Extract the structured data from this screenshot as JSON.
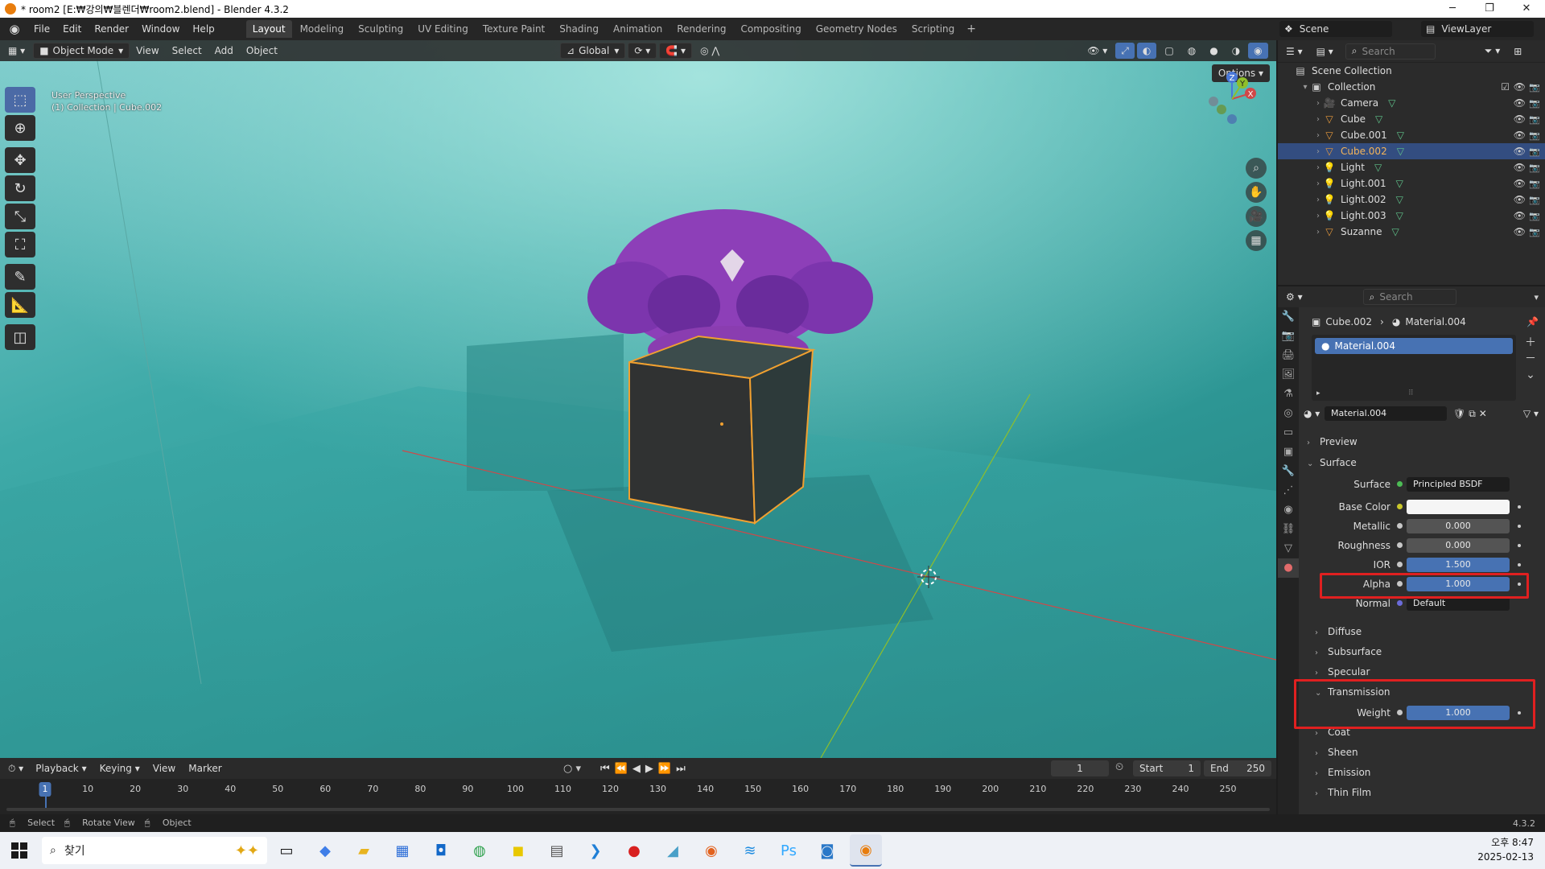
{
  "window": {
    "title": "* room2 [E:₩강의₩블렌더₩room2.blend] - Blender 4.3.2",
    "controls": [
      "─",
      "❐",
      "✕"
    ]
  },
  "menu": [
    "File",
    "Edit",
    "Render",
    "Window",
    "Help"
  ],
  "workspaces": [
    "Layout",
    "Modeling",
    "Sculpting",
    "UV Editing",
    "Texture Paint",
    "Shading",
    "Animation",
    "Rendering",
    "Compositing",
    "Geometry Nodes",
    "Scripting"
  ],
  "workspace_add": "+",
  "scene": "Scene",
  "view_layer": "ViewLayer",
  "viewport": {
    "mode": "Object Mode",
    "menus": [
      "View",
      "Select",
      "Add",
      "Object"
    ],
    "transform": "Global",
    "perspective": "User Perspective",
    "collection_info": "(1) Collection | Cube.002",
    "options": "Options",
    "gizmo": {
      "z": "Z",
      "y": "Y",
      "x": "X"
    }
  },
  "outliner": {
    "search_placeholder": "Search",
    "scene_collection": "Scene Collection",
    "collection": "Collection",
    "items": [
      {
        "name": "Camera",
        "icon": "camera-icon",
        "color": "#e89a3c"
      },
      {
        "name": "Cube",
        "icon": "mesh-icon",
        "color": "#e89a3c"
      },
      {
        "name": "Cube.001",
        "icon": "mesh-icon",
        "color": "#e89a3c"
      },
      {
        "name": "Cube.002",
        "icon": "mesh-icon",
        "color": "#e89a3c",
        "selected": true
      },
      {
        "name": "Light",
        "icon": "light-icon",
        "color": "#e89a3c"
      },
      {
        "name": "Light.001",
        "icon": "light-icon",
        "color": "#e89a3c"
      },
      {
        "name": "Light.002",
        "icon": "light-icon",
        "color": "#e89a3c"
      },
      {
        "name": "Light.003",
        "icon": "light-icon",
        "color": "#e89a3c"
      },
      {
        "name": "Suzanne",
        "icon": "mesh-icon",
        "color": "#e89a3c"
      }
    ]
  },
  "properties": {
    "search_placeholder": "Search",
    "breadcrumb_object": "Cube.002",
    "breadcrumb_material": "Material.004",
    "slot_name": "Material.004",
    "material_name": "Material.004",
    "sections": {
      "preview": "Preview",
      "surface": "Surface"
    },
    "surface_label": "Surface",
    "surface_value": "Principled BSDF",
    "fields": [
      {
        "label": "Base Color",
        "value": ""
      },
      {
        "label": "Metallic",
        "value": "0.000"
      },
      {
        "label": "Roughness",
        "value": "0.000"
      },
      {
        "label": "IOR",
        "value": "1.500"
      },
      {
        "label": "Alpha",
        "value": "1.000"
      },
      {
        "label": "Normal",
        "value": "Default"
      }
    ],
    "subsections": [
      "Diffuse",
      "Subsurface",
      "Specular"
    ],
    "transmission": "Transmission",
    "weight_label": "Weight",
    "weight_value": "1.000",
    "more_sections": [
      "Coat",
      "Sheen",
      "Emission",
      "Thin Film"
    ],
    "version": "4.3.2"
  },
  "timeline": {
    "menus": [
      "Playback",
      "Keying",
      "View",
      "Marker"
    ],
    "current_frame": "1",
    "start_label": "Start",
    "start": "1",
    "end_label": "End",
    "end": "250",
    "ticks": [
      "1",
      "10",
      "20",
      "30",
      "40",
      "50",
      "60",
      "70",
      "80",
      "90",
      "100",
      "110",
      "120",
      "130",
      "140",
      "150",
      "160",
      "170",
      "180",
      "190",
      "200",
      "210",
      "220",
      "230",
      "240",
      "250"
    ]
  },
  "statusbar": [
    "Select",
    "Rotate View",
    "Object"
  ],
  "taskbar": {
    "search_text": "찾기",
    "time": "오후 8:47",
    "date": "2025-02-13"
  }
}
